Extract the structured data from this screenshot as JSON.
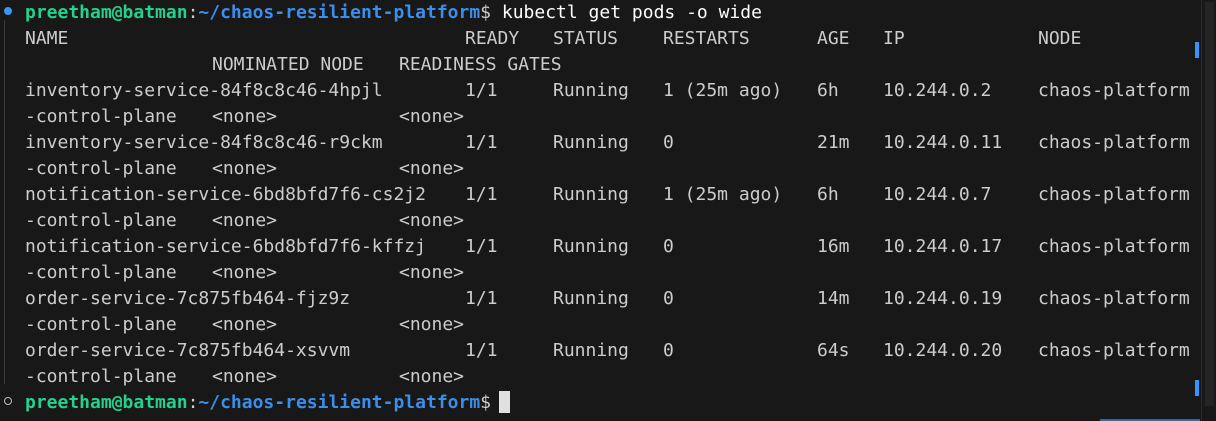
{
  "prompt": {
    "user_host": "preetham@batman",
    "separator": ":",
    "path": "~/chaos-resilient-platform",
    "dollar": "$"
  },
  "command": " kubectl get pods -o wide",
  "headers": {
    "name": "NAME",
    "ready": "READY",
    "status": "STATUS",
    "restarts": "RESTARTS",
    "age": "AGE",
    "ip": "IP",
    "node": "NODE",
    "nominated_node": "NOMINATED NODE",
    "readiness_gates": "READINESS GATES"
  },
  "pods": [
    {
      "name": "inventory-service-84f8c8c46-4hpjl",
      "ready": "1/1",
      "status": "Running",
      "restarts": "1 (25m ago)",
      "age": "6h",
      "ip": "10.244.0.2",
      "node": "chaos-platform",
      "node_cont": "-control-plane",
      "nominated": "<none>",
      "gates": "<none>"
    },
    {
      "name": "inventory-service-84f8c8c46-r9ckm",
      "ready": "1/1",
      "status": "Running",
      "restarts": "0",
      "age": "21m",
      "ip": "10.244.0.11",
      "node": "chaos-platform",
      "node_cont": "-control-plane",
      "nominated": "<none>",
      "gates": "<none>"
    },
    {
      "name": "notification-service-6bd8bfd7f6-cs2j2",
      "ready": "1/1",
      "status": "Running",
      "restarts": "1 (25m ago)",
      "age": "6h",
      "ip": "10.244.0.7",
      "node": "chaos-platform",
      "node_cont": "-control-plane",
      "nominated": "<none>",
      "gates": "<none>"
    },
    {
      "name": "notification-service-6bd8bfd7f6-kffzj",
      "ready": "1/1",
      "status": "Running",
      "restarts": "0",
      "age": "16m",
      "ip": "10.244.0.17",
      "node": "chaos-platform",
      "node_cont": "-control-plane",
      "nominated": "<none>",
      "gates": "<none>"
    },
    {
      "name": "order-service-7c875fb464-fjz9z",
      "ready": "1/1",
      "status": "Running",
      "restarts": "0",
      "age": "14m",
      "ip": "10.244.0.19",
      "node": "chaos-platform",
      "node_cont": "-control-plane",
      "nominated": "<none>",
      "gates": "<none>"
    },
    {
      "name": "order-service-7c875fb464-xsvvm",
      "ready": "1/1",
      "status": "Running",
      "restarts": "0",
      "age": "64s",
      "ip": "10.244.0.20",
      "node": "chaos-platform",
      "node_cont": "-control-plane",
      "nominated": "<none>",
      "gates": "<none>"
    }
  ],
  "colors": {
    "background": "#181818",
    "prompt_user": "#23d18b",
    "prompt_path": "#3b8eea",
    "text": "#cccccc"
  }
}
